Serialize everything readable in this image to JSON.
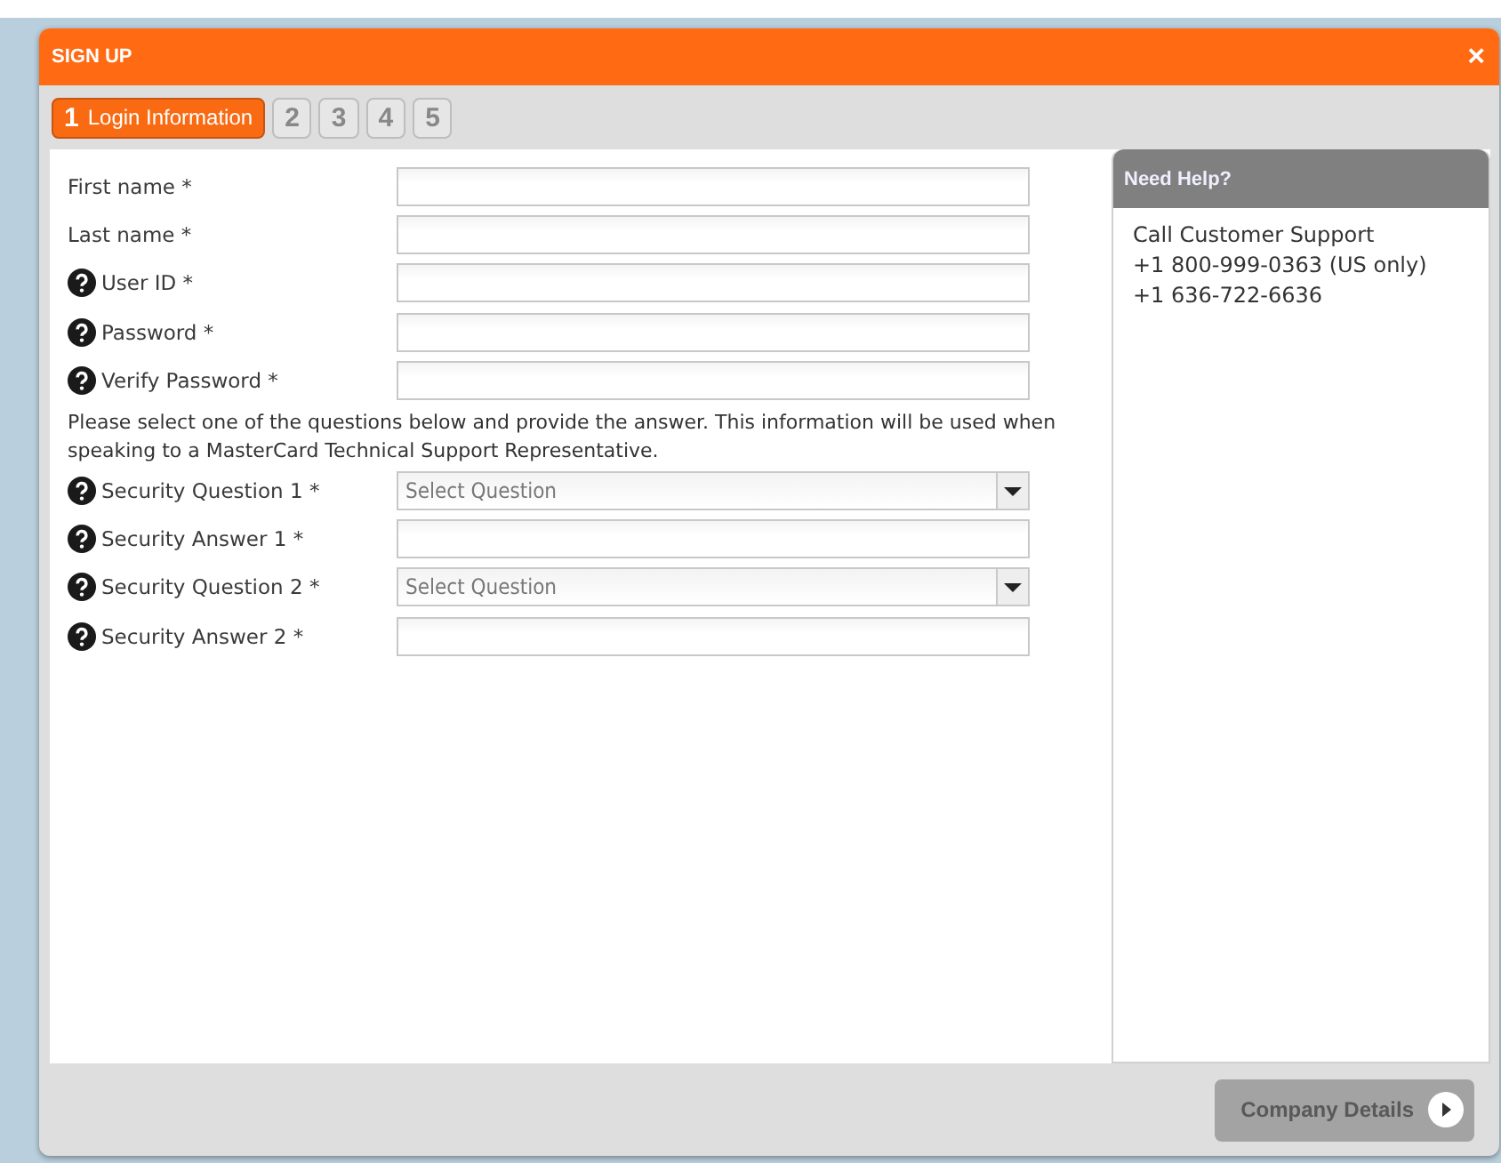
{
  "dialog": {
    "title": "SIGN UP",
    "close": "×"
  },
  "steps": [
    {
      "number": "1",
      "label": "Login Information",
      "selected": true
    },
    {
      "number": "2",
      "selected": false
    },
    {
      "number": "3",
      "selected": false
    },
    {
      "number": "4",
      "selected": false
    },
    {
      "number": "5",
      "selected": false
    }
  ],
  "form": [
    {
      "kind": "text",
      "label": "First name *",
      "help": false
    },
    {
      "kind": "text",
      "label": "Last name *",
      "help": false
    },
    {
      "kind": "text",
      "label": "User ID *",
      "help": true
    },
    {
      "kind": "text",
      "label": "Password *",
      "help": true
    },
    {
      "kind": "text",
      "label": "Verify Password *",
      "help": true
    },
    {
      "kind": "note",
      "text": "Please select one of the questions below and provide the answer. This information will be used when speaking to a MasterCard Technical Support Representative."
    },
    {
      "kind": "select",
      "label": "Security Question 1 *",
      "help": true,
      "placeholder": "Select Question"
    },
    {
      "kind": "text",
      "label": "Security Answer 1 *",
      "help": true
    },
    {
      "kind": "select",
      "label": "Security Question 2 *",
      "help": true,
      "placeholder": "Select Question"
    },
    {
      "kind": "text",
      "label": "Security Answer 2 *",
      "help": true
    }
  ],
  "help_panel": {
    "title": "Need Help?",
    "lines": [
      "Call Customer Support",
      "+1 800-999-0363 (US only)",
      "+1 636-722-6636"
    ]
  },
  "next_button": {
    "label": "Company Details",
    "disabled": true
  }
}
